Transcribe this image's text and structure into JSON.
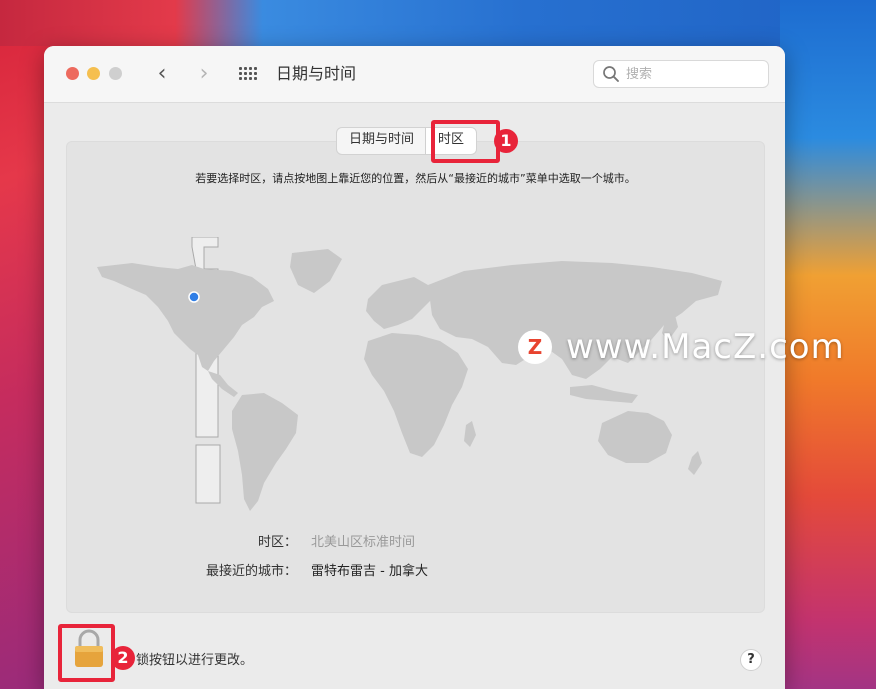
{
  "window": {
    "title": "日期与时间",
    "search_placeholder": "搜索"
  },
  "tabs": [
    {
      "label": "日期与时间",
      "active": false
    },
    {
      "label": "时区",
      "active": true
    }
  ],
  "panel": {
    "instruction": "若要选择时区，请点按地图上靠近您的位置，然后从“最接近的城市”菜单中选取一个城市。",
    "timezone_label": "时区：",
    "timezone_value": "北美山区标准时间",
    "closest_city_label": "最接近的城市：",
    "closest_city_value": "雷特布雷吉 - 加拿大"
  },
  "footer": {
    "lock_text": "锁按钮以进行更改。",
    "help": "?"
  },
  "annotations": [
    {
      "number": "1"
    },
    {
      "number": "2"
    }
  ],
  "watermark": {
    "logo": "Z",
    "text": "www.MacZ.com"
  },
  "icons": {
    "search": "search-icon",
    "lock": "lock-icon",
    "grid": "grid-icon",
    "back": "chevron-left-icon",
    "forward": "chevron-right-icon"
  },
  "colors": {
    "annotation": "#e8243a",
    "selected_location": "#2f7ee6",
    "map_land": "#c8c8c8"
  }
}
